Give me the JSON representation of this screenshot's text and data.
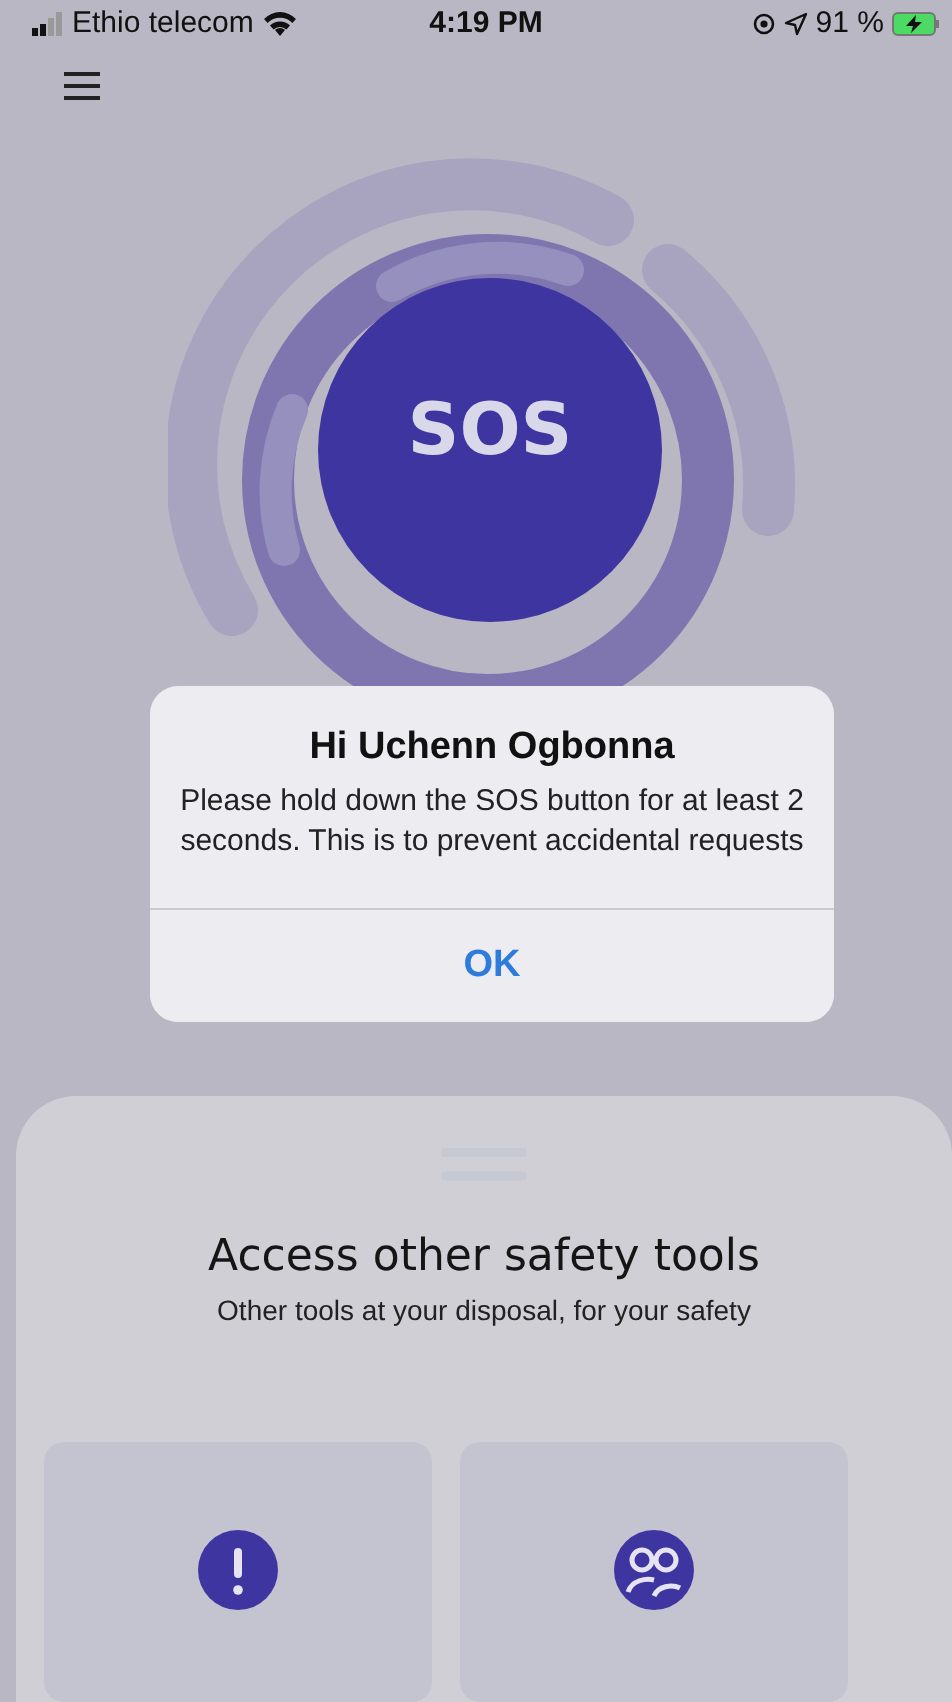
{
  "status_bar": {
    "carrier": "Ethio telecom",
    "time": "4:19 PM",
    "battery": "91 %"
  },
  "sos": {
    "label": "SOS"
  },
  "dialog": {
    "title": "Hi Uchenn Ogbonna",
    "message": "Please hold down the SOS button for at least 2 seconds. This is to prevent accidental requests",
    "button": "OK"
  },
  "sheet": {
    "title": "Access other safety tools",
    "subtitle": "Other tools at your disposal, for your safety",
    "tools": [
      {
        "kind": "alert"
      },
      {
        "kind": "group"
      }
    ]
  }
}
